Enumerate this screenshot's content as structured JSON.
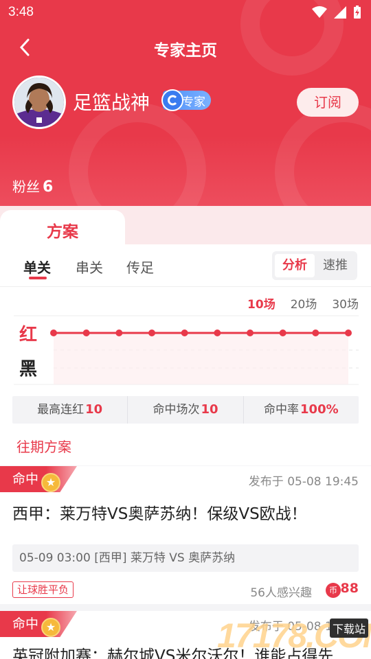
{
  "status": {
    "time": "3:48"
  },
  "header": {
    "title": "专家主页",
    "back_icon": "chevron-left-icon"
  },
  "profile": {
    "name": "足篮战神",
    "badge": "专家",
    "subscribe_label": "订阅",
    "fans_label": "粉丝",
    "fans_count": "6"
  },
  "tabs": {
    "main": "方案",
    "sub": [
      "单关",
      "串关",
      "传足"
    ],
    "segment": [
      "分析",
      "速推"
    ]
  },
  "ranges": [
    "10场",
    "20场",
    "30场"
  ],
  "chart_data": {
    "type": "line",
    "y_categories": [
      "红",
      "黑"
    ],
    "x": [
      1,
      2,
      3,
      4,
      5,
      6,
      7,
      8,
      9,
      10
    ],
    "values": [
      "红",
      "红",
      "红",
      "红",
      "红",
      "红",
      "红",
      "红",
      "红",
      "红"
    ],
    "color": "#e8394a"
  },
  "stats": [
    {
      "label": "最高连红",
      "value": "10"
    },
    {
      "label": "命中场次",
      "value": "10"
    },
    {
      "label": "命中率",
      "value": "100%"
    }
  ],
  "past_label": "往期方案",
  "items": [
    {
      "status": "命中",
      "posted": "发布于  05-08 19:45",
      "title": "西甲：莱万特VS奥萨苏纳！保级VS欧战！",
      "match": "05-09 03:00   [西甲] 莱万特 VS 奥萨苏纳",
      "tag": "让球胜平负",
      "interest": "56人感兴趣",
      "price": "88"
    },
    {
      "status": "命中",
      "posted": "发布于  05-08 19:46",
      "title": "英冠附加赛：赫尔城VS米尔沃尔！谁能占得先"
    }
  ],
  "watermark": {
    "text": "17178.COM",
    "tag": "下载站"
  },
  "colors": {
    "accent": "#e8394a"
  }
}
